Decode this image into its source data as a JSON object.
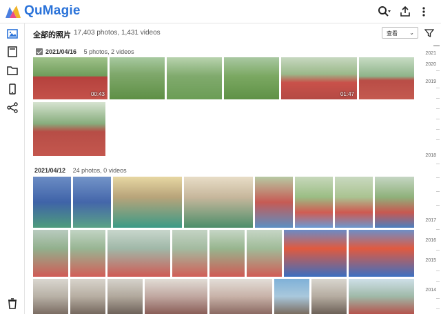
{
  "app": {
    "brand": "QuMagie"
  },
  "header": {
    "title": "全部的照片",
    "count": "17,403 photos, 1,431 videos"
  },
  "view_select": {
    "value": "查看"
  },
  "groups": [
    {
      "date": "2021/04/16",
      "summary": "5 photos, 2 videos"
    },
    {
      "date": "2021/04/12",
      "summary": "24 photos, 0 videos"
    }
  ],
  "durations": [
    "00:43",
    "01:47"
  ],
  "timeline": {
    "years": [
      "2021",
      "2020",
      "2019",
      "2018",
      "2017",
      "2016",
      "2015",
      "2014"
    ]
  },
  "icons": {
    "top": [
      "search-icon",
      "upload-icon",
      "more-icon"
    ],
    "sidebar": [
      "photos-icon",
      "album-icon",
      "folder-icon",
      "device-icon",
      "share-icon",
      "trash-icon"
    ]
  }
}
